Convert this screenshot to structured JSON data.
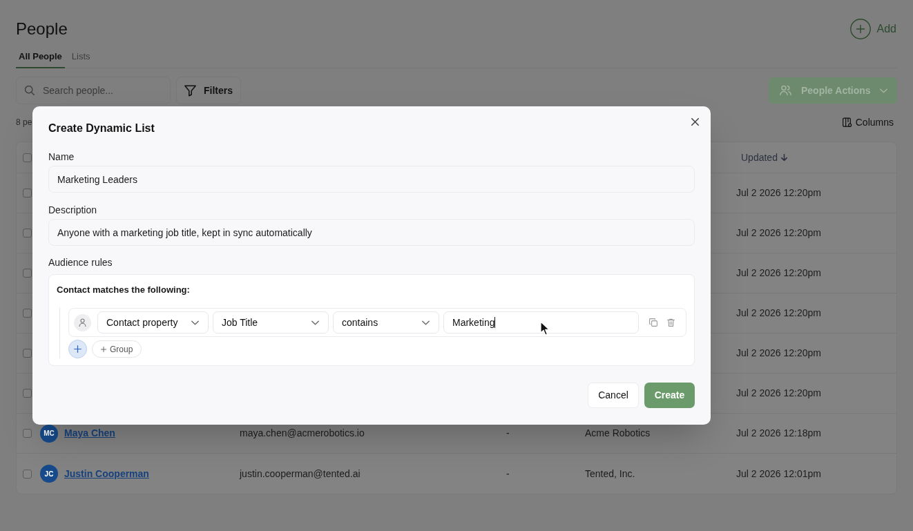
{
  "page": {
    "title": "People",
    "add_button": "Add"
  },
  "tabs": [
    {
      "label": "All People",
      "selected": true
    },
    {
      "label": "Lists",
      "selected": false
    }
  ],
  "toolbar": {
    "search": {
      "placeholder": "Search people..."
    },
    "filters_button": "Filters",
    "actions_button": {
      "label": "People Actions",
      "disabled": true
    }
  },
  "count_label": "8 pe",
  "columns_button": "Columns",
  "table": {
    "select_all": {
      "checked": false
    },
    "sorted_column": {
      "label": "Updated",
      "descending": true
    },
    "rows": [
      {
        "checked": false,
        "updated": "Jul 2 2026 12:20pm"
      },
      {
        "checked": false,
        "updated": "Jul 2 2026 12:20pm"
      },
      {
        "checked": false,
        "updated": "Jul 2 2026 12:20pm"
      },
      {
        "checked": false,
        "updated": "Jul 2 2026 12:20pm"
      },
      {
        "checked": false,
        "updated": "Jul 2 2026 12:20pm"
      },
      {
        "checked": false,
        "updated": "Jul 2 2026 12:20pm"
      },
      {
        "checked": false,
        "initials": "MC",
        "name": "Maya Chen",
        "email": "maya.chen@acmerobotics.io",
        "column_3": "-",
        "company": "Acme Robotics",
        "updated": "Jul 2 2026 12:18pm"
      },
      {
        "checked": false,
        "initials": "JC",
        "name": "Justin Cooperman",
        "email": "justin.cooperman@tented.ai",
        "column_3": "-",
        "company": "Tented, Inc.",
        "updated": "Jul 2 2026 12:01pm"
      }
    ]
  },
  "modal": {
    "title": "Create Dynamic List",
    "fields": [
      {
        "label": "Name",
        "value": "Marketing Leaders"
      },
      {
        "label": "Description",
        "value": "Anyone with a marketing job title, kept in sync automatically"
      }
    ],
    "audience_rules": {
      "label": "Audience rules",
      "heading": "Contact matches the following:",
      "conditions": [
        {
          "source": "Contact property",
          "property": "Job Title",
          "operator": "contains",
          "value": "Marketing"
        }
      ],
      "group_button": "Group"
    },
    "buttons": [
      {
        "label": "Cancel",
        "kind": "secondary"
      },
      {
        "label": "Create",
        "kind": "primary"
      }
    ]
  }
}
